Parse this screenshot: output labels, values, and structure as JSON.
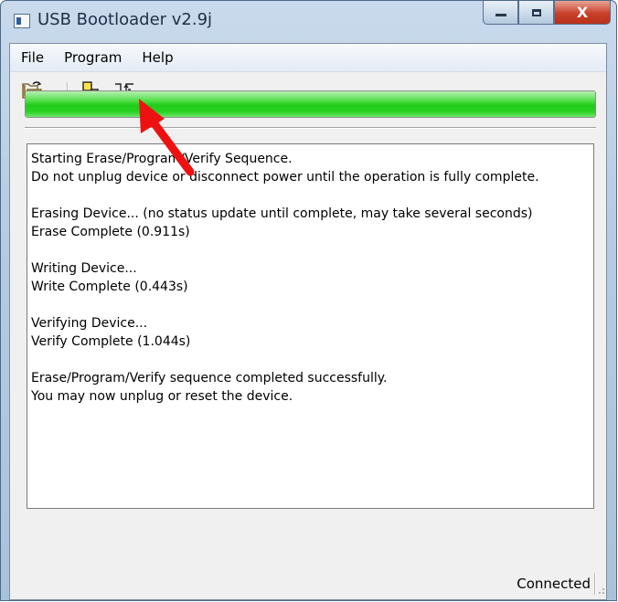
{
  "window": {
    "title": "USB Bootloader v2.9j",
    "close_glyph": "X"
  },
  "menu": {
    "items": [
      "File",
      "Program",
      "Help"
    ]
  },
  "toolbar": {
    "buttons": [
      "open-hex-icon",
      "erase-program-verify-icon",
      "reset-device-icon"
    ]
  },
  "progress": {
    "percent": 100,
    "color": "#22cc1a"
  },
  "log": {
    "lines": [
      "Starting Erase/Program/Verify Sequence.",
      "Do not unplug device or disconnect power until the operation is fully complete.",
      "",
      "Erasing Device... (no status update until complete, may take several seconds)",
      "Erase Complete (0.911s)",
      "",
      "Writing Device...",
      "Write Complete (0.443s)",
      "",
      "Verifying Device...",
      "Verify Complete (1.044s)",
      "",
      "Erase/Program/Verify sequence completed successfully.",
      "You may now unplug or reset the device."
    ]
  },
  "status": {
    "text": "Connected"
  },
  "annotation": {
    "color": "#ee1111"
  }
}
